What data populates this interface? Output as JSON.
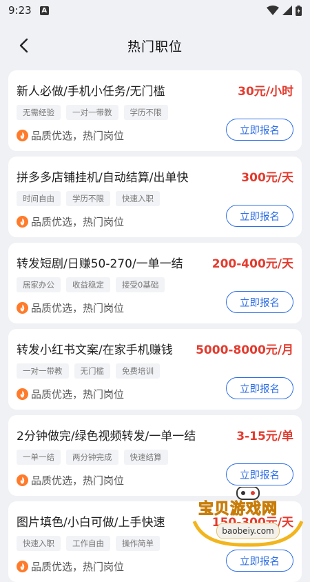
{
  "status_bar": {
    "time": "9:23",
    "notif_letter": "A"
  },
  "header": {
    "title": "热门职位"
  },
  "quality_text": "品质优选，热门岗位",
  "apply_label": "立即报名",
  "colors": {
    "pay": "#e33b2e",
    "accent": "#2f6fe6",
    "flame": "#ff7a2a"
  },
  "jobs": [
    {
      "title": "新人必做/手机小任务/无门槛",
      "pay": "30元/小时",
      "tags": [
        "无需经验",
        "一对一带教",
        "学历不限"
      ]
    },
    {
      "title": "拼多多店铺挂机/自动结算/出单快",
      "pay": "300元/天",
      "tags": [
        "时间自由",
        "学历不限",
        "快速入职"
      ]
    },
    {
      "title": "转发短剧/日赚50-270/一单一结",
      "pay": "200-400元/天",
      "tags": [
        "居家办公",
        "收益稳定",
        "接受0基础"
      ]
    },
    {
      "title": "转发小红书文案/在家手机赚钱",
      "pay": "5000-8000元/月",
      "tags": [
        "一对一带教",
        "无门槛",
        "免费培训"
      ]
    },
    {
      "title": "2分钟做完/绿色视频转发/一单一结",
      "pay": "3-15元/单",
      "tags": [
        "一单一结",
        "两分钟完成",
        "快速结算"
      ]
    },
    {
      "title": "图片填色/小白可做/上手快速",
      "pay": "150-300元/天",
      "tags": [
        "快速入职",
        "工作自由",
        "操作简单"
      ]
    }
  ],
  "watermark": {
    "text": "宝贝游戏网",
    "url": "baobeiy.com"
  }
}
